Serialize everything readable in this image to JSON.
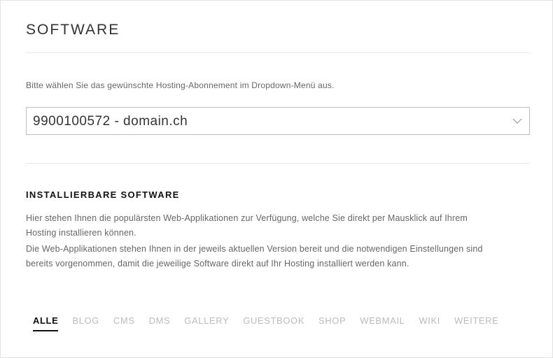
{
  "page": {
    "title": "SOFTWARE",
    "instruction": "Bitte wählen Sie das gewünschte Hosting-Abonnement im Dropdown-Menü aus."
  },
  "subscription_select": {
    "selected": "9900100572 - domain.ch"
  },
  "section": {
    "title": "INSTALLIERBARE SOFTWARE",
    "paragraph1": "Hier stehen Ihnen die populärsten Web-Applikationen zur Verfügung, welche Sie direkt per Mausklick auf Ihrem Hosting installieren können.",
    "paragraph2": "Die Web-Applikationen stehen Ihnen in der jeweils aktuellen Version bereit und die notwendigen Einstellungen sind bereits vorgenommen, damit die jeweilige Software direkt auf Ihr Hosting installiert werden kann."
  },
  "tabs": [
    {
      "label": "ALLE",
      "active": true
    },
    {
      "label": "BLOG",
      "active": false
    },
    {
      "label": "CMS",
      "active": false
    },
    {
      "label": "DMS",
      "active": false
    },
    {
      "label": "GALLERY",
      "active": false
    },
    {
      "label": "GUESTBOOK",
      "active": false
    },
    {
      "label": "SHOP",
      "active": false
    },
    {
      "label": "WEBMAIL",
      "active": false
    },
    {
      "label": "WIKI",
      "active": false
    },
    {
      "label": "WEITERE",
      "active": false
    }
  ],
  "icons": {
    "dropdown": "chevron-down-icon"
  },
  "colors": {
    "active_tab": "#111111",
    "inactive_tab": "#bbbbbb",
    "border": "#bdbdbd"
  }
}
